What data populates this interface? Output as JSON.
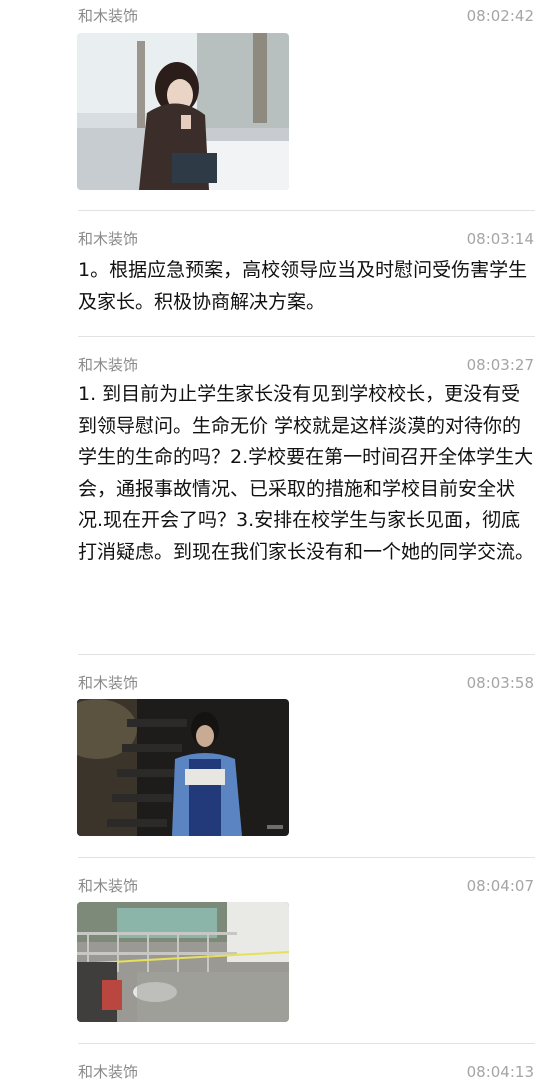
{
  "messages": [
    {
      "sender": "和木装饰",
      "time": "08:02:42",
      "type": "image",
      "image": "photo-woman-sitting-with-phone"
    },
    {
      "sender": "和木装饰",
      "time": "08:03:14",
      "type": "text",
      "text": "1。根据应急预案，高校领导应当及时慰问受伤害学生及家长。积极协商解决方案。"
    },
    {
      "sender": "和木装饰",
      "time": "08:03:27",
      "type": "text",
      "text": "1. 到目前为止学生家长没有见到学校校长，更没有受到领导慰问。生命无价 学校就是这样淡漠的对待你的学生的生命的吗？2.学校要在第一时间召开全体学生大会，通报事故情况、已采取的措施和学校目前安全状况.现在开会了吗？3.安排在校学生与家长见面，彻底打消疑虑。到现在我们家长没有和一个她的同学交流。"
    },
    {
      "sender": "和木装饰",
      "time": "08:03:58",
      "type": "image",
      "image": "photo-girl-on-dark-stairs"
    },
    {
      "sender": "和木装饰",
      "time": "08:04:07",
      "type": "image",
      "image": "photo-railing-with-police-tape"
    },
    {
      "sender": "和木装饰",
      "time": "08:04:13",
      "type": "text",
      "text": ""
    }
  ]
}
